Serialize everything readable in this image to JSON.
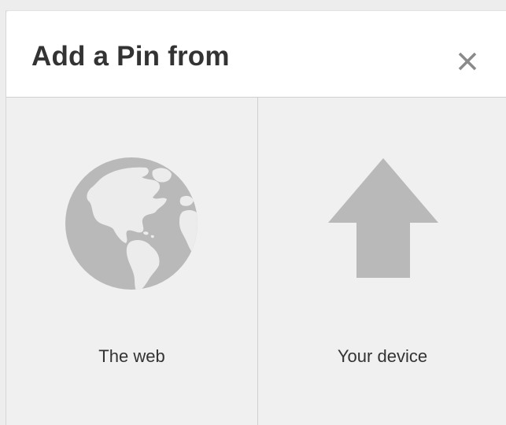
{
  "dialog": {
    "title": "Add a Pin from",
    "close_icon": "close-icon"
  },
  "options": [
    {
      "label": "The web",
      "icon": "globe-icon"
    },
    {
      "label": "Your device",
      "icon": "upload-arrow-icon"
    }
  ],
  "colors": {
    "header_bg": "#ffffff",
    "panel_bg": "#f0f0f0",
    "icon_gray": "#b9b9b9",
    "title_text": "#333333",
    "close_gray": "#8a8a8a",
    "divider": "#cfcfcf"
  }
}
